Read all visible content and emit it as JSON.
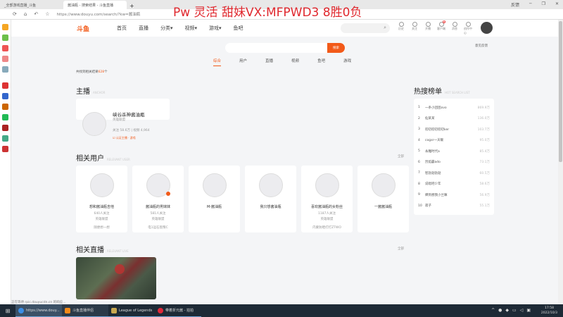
{
  "browser": {
    "tabs": [
      "_全部游戏直播_斗鱼",
      "酱油瓶 - 搜索结果 - 斗鱼直播"
    ],
    "new_tab": "+",
    "url": "https://www.douyu.com/search/?kw=酱油瓶",
    "window_controls": [
      "反馈",
      "─",
      "❐",
      "✕"
    ]
  },
  "overlay_text": "Pw 灵活 甜妹VX:MFPWD3 8胜0负",
  "header": {
    "logo": "斗鱼",
    "nav": [
      "首页",
      "直播",
      "分类▾",
      "视频▾",
      "游戏▾",
      "鱼吧"
    ],
    "icons": [
      {
        "label": "历史",
        "name": "history-icon"
      },
      {
        "label": "关注",
        "name": "follow-icon"
      },
      {
        "label": "开播",
        "name": "broadcast-icon"
      },
      {
        "label": "客户端",
        "name": "client-icon"
      },
      {
        "label": "消息",
        "name": "message-icon"
      },
      {
        "label": "创作中心",
        "name": "creator-icon"
      }
    ],
    "client_badge": "8"
  },
  "search": {
    "button": "搜索",
    "value": "",
    "feedback": "意见反馈",
    "tabs": [
      "综合",
      "用户",
      "直播",
      "视频",
      "鱼吧",
      "游戏"
    ],
    "result_prefix": "共找到相关结果",
    "result_count": "628",
    "result_suffix": "个"
  },
  "anchor": {
    "title": "主播",
    "subtitle": "ANCHOR",
    "name": "峡谷杀神酱油瓶",
    "category": "英雄联盟",
    "stats": "关注 58.6万 | 视频 4,964",
    "tag": "☑ 认证主播 · 游戏"
  },
  "users": {
    "title": "相关用户",
    "subtitle": "RELEVANT USER",
    "more": "全部",
    "items": [
      {
        "name": "想和酱油瓶吉他",
        "fans": "640人关注",
        "cat": "英雄联盟",
        "desc": "随便想一想"
      },
      {
        "name": "酱油瓶的男妹妹",
        "fans": "581人关注",
        "cat": "英雄联盟",
        "desc": "电1运石窗叛C"
      },
      {
        "name": "M-酱油瓶",
        "fans": "",
        "cat": "",
        "desc": ""
      },
      {
        "name": "我只想酱油瓶",
        "fans": "",
        "cat": "",
        "desc": ""
      },
      {
        "name": "喜欢酱油瓶的女粉丝",
        "fans": "1187人关注",
        "cat": "英雄联盟",
        "desc": "内蒙防晒打打ZTWO"
      },
      {
        "name": "一酱酱油瓶",
        "fans": "",
        "cat": "",
        "desc": ""
      }
    ]
  },
  "live": {
    "title": "相关直播",
    "subtitle": "RELEVANT LIVE",
    "more": "全部"
  },
  "hot": {
    "title": "热搜榜单",
    "subtitle": "HOT SEARCH LIST",
    "items": [
      {
        "rank": "1",
        "name": "一条小团团ovo",
        "value": "869.9万"
      },
      {
        "rank": "2",
        "name": "仙某某",
        "value": "136.0万"
      },
      {
        "rank": "3",
        "name": "叨叨叨叨叨叨ker",
        "value": "103.7万"
      },
      {
        "rank": "4",
        "name": "cogxr一天暖",
        "value": "95.0万"
      },
      {
        "rank": "5",
        "name": "永雕时代a",
        "value": "85.4万"
      },
      {
        "rank": "6",
        "name": "烈焰霸ado",
        "value": "73.1万"
      },
      {
        "rank": "7",
        "name": "智勃勃勃勃",
        "value": "60.5万"
      },
      {
        "rank": "8",
        "name": "说唱吧少年",
        "value": "58.6万"
      },
      {
        "rank": "9",
        "name": "蝉到想我小兰嘛",
        "value": "56.9万"
      },
      {
        "rank": "10",
        "name": "寂子",
        "value": "55.1万"
      }
    ]
  },
  "status_bar": "正在等待 rpic.douyucdn.cn 的响应...",
  "taskbar": {
    "items": [
      "https://www.douy...",
      "斗鱼直播伴侣",
      "League of Legends",
      "带着折元酱 - 拍拍"
    ],
    "time": "17:58",
    "date": "2022/10/3"
  }
}
